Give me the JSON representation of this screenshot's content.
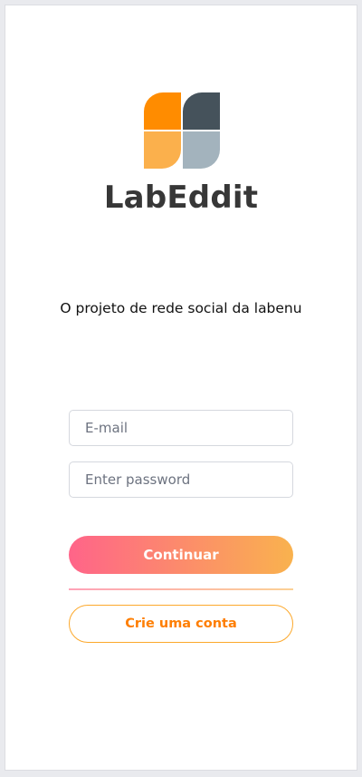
{
  "brand": {
    "name": "LabEddit",
    "logo_icon": "labeddit-logo-icon",
    "logo_colors": [
      "#ff8c00",
      "#fbb04c",
      "#45525b",
      "#a3b3bd"
    ]
  },
  "tagline": "O projeto de rede social da labenu",
  "form": {
    "email_placeholder": "E-mail",
    "password_placeholder": "Enter password"
  },
  "actions": {
    "continue_label": "Continuar",
    "signup_label": "Crie uma conta"
  },
  "colors": {
    "gradient_start": "#ff6489",
    "gradient_end": "#f9b24e",
    "secondary_text": "#fe7e02",
    "secondary_border": "#fca82b"
  }
}
